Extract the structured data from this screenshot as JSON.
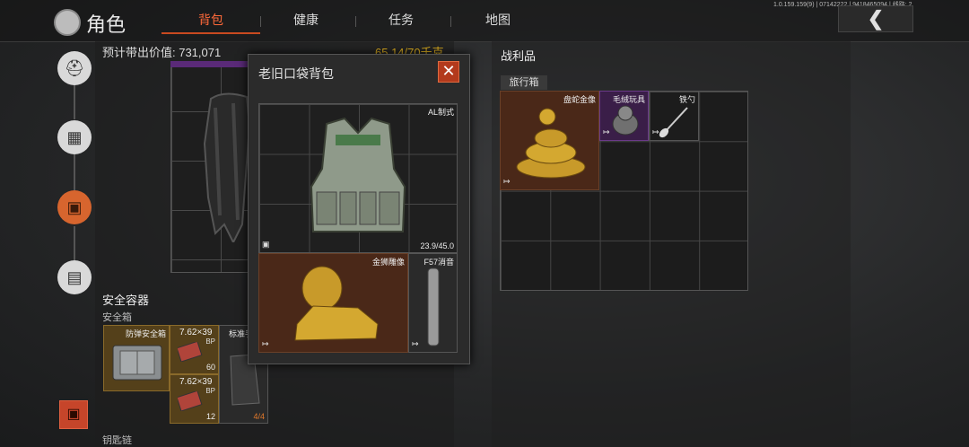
{
  "header": {
    "title": "角色",
    "tabs": [
      {
        "label": "背包",
        "active": true
      },
      {
        "label": "健康",
        "active": false
      },
      {
        "label": "任务",
        "active": false
      },
      {
        "label": "地图",
        "active": false
      }
    ],
    "version": "1.0.159.159(9) | 07142222 | 9418465094 | 线路: 2",
    "back_icon": "❮"
  },
  "left_panel": {
    "value_label": "预计带出价值: 731,071",
    "weight": "65.14/70千克",
    "secure_title": "安全容器",
    "secure_sub": "安全箱",
    "secure_box_label": "防弹安全箱",
    "ammo1": {
      "caliber": "7.62×39",
      "type": "BP",
      "count": "60"
    },
    "ammo2": {
      "caliber": "7.62×39",
      "type": "BP",
      "count": "12"
    },
    "standard_label": "标准手",
    "standard_count": "4/4",
    "keychain": "钥匙链"
  },
  "popup": {
    "title": "老旧口袋背包",
    "close": "✕",
    "armor_label": "AL制式",
    "armor_durability": "23.9/45.0",
    "lion_label": "金狮雕像",
    "suppressor_label": "F57消音"
  },
  "loot": {
    "title": "战利品",
    "tab": "旅行箱",
    "snake_label": "盘蛇金像",
    "plush_label": "毛绒玩具",
    "spoon_label": "铁勺"
  },
  "colors": {
    "accent": "#ff6a3a",
    "weight": "#e0b020",
    "close": "#b33a1c"
  }
}
